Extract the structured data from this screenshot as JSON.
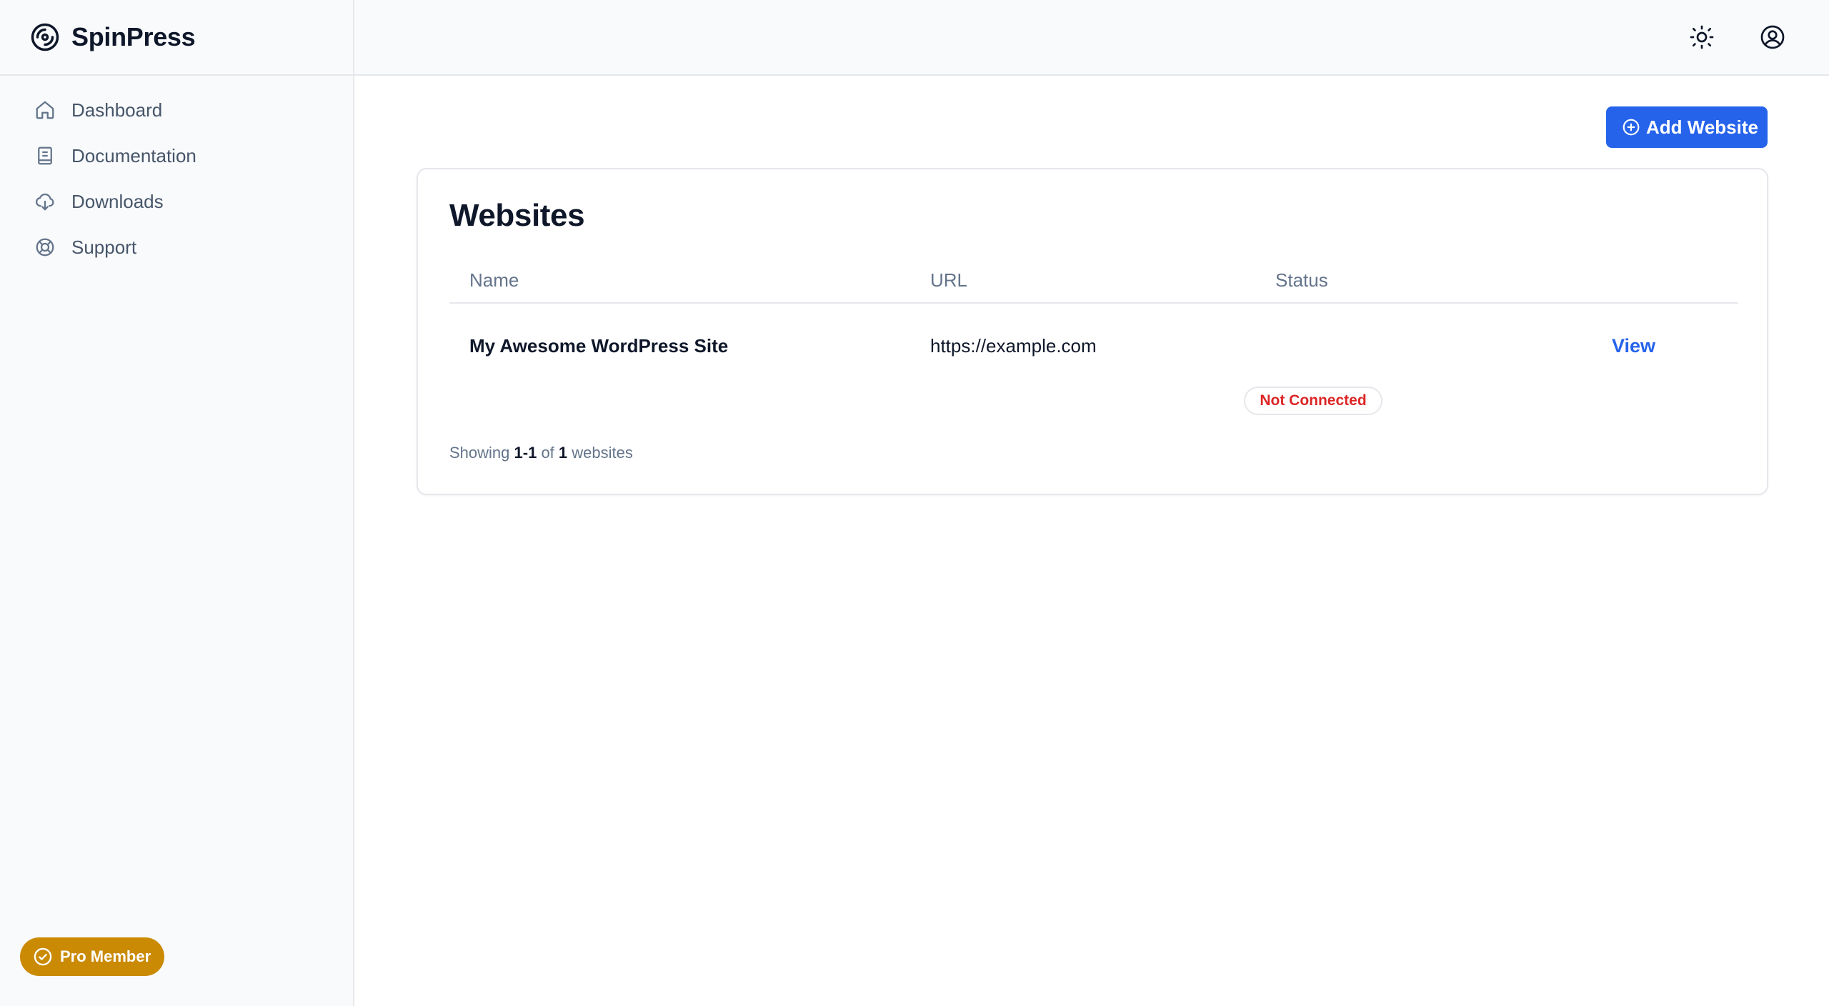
{
  "brand": {
    "name": "SpinPress",
    "logo_icon": "disc-icon"
  },
  "sidebar": {
    "items": [
      {
        "label": "Dashboard",
        "icon": "home-icon"
      },
      {
        "label": "Documentation",
        "icon": "book-icon"
      },
      {
        "label": "Downloads",
        "icon": "cloud-download-icon"
      },
      {
        "label": "Support",
        "icon": "lifebuoy-icon"
      }
    ],
    "membership": {
      "label": "Pro Member",
      "icon": "check-circle-icon",
      "color": "#ca8a04"
    }
  },
  "topbar": {
    "theme_icon": "sun-icon",
    "account_icon": "user-circle-icon"
  },
  "main": {
    "add_button_label": "Add Website",
    "add_button_icon": "plus-circle-icon",
    "card_title": "Websites",
    "columns": [
      "Name",
      "URL",
      "Status"
    ],
    "rows": [
      {
        "name": "My Awesome WordPress Site",
        "url": "https://example.com",
        "status": "Not Connected",
        "action": "View"
      }
    ],
    "footer": {
      "prefix": "Showing",
      "range": "1-1",
      "of_word": "of",
      "total": "1",
      "suffix": "websites"
    }
  },
  "colors": {
    "accent": "#2563eb",
    "status_error": "#dc2626",
    "badge_gold": "#ca8a04",
    "sidebar_bg": "#f8fafc"
  }
}
